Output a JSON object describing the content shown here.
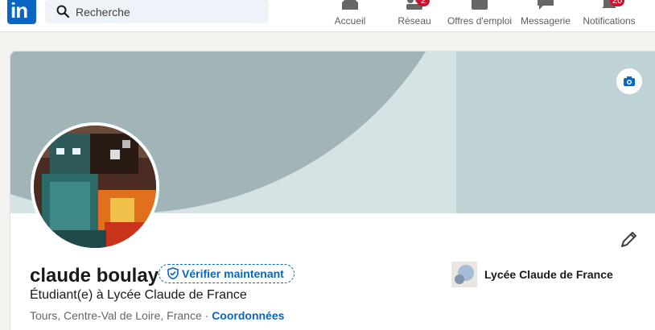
{
  "nav": {
    "logo_text": "in",
    "search_placeholder": "Recherche",
    "items": [
      {
        "label": "Accueil",
        "icon": "home-icon"
      },
      {
        "label": "Réseau",
        "icon": "network-icon",
        "badge": "2"
      },
      {
        "label": "Offres d'emploi",
        "icon": "jobs-icon"
      },
      {
        "label": "Messagerie",
        "icon": "messaging-icon"
      },
      {
        "label": "Notifications",
        "icon": "bell-icon",
        "badge": "20"
      }
    ]
  },
  "profile": {
    "name": "claude boulay",
    "verify_label": "Vérifier maintenant",
    "headline": "Étudiant(e) à Lycée Claude de France",
    "location": "Tours, Centre-Val de Loire, France",
    "separator": " · ",
    "contact_label": "Coordonnées",
    "school": "Lycée Claude de France"
  },
  "colors": {
    "brand": "#0a66c2",
    "badge": "#cb112d",
    "banner_dark": "#a1b4b8",
    "banner_light": "#bfd2d5"
  }
}
